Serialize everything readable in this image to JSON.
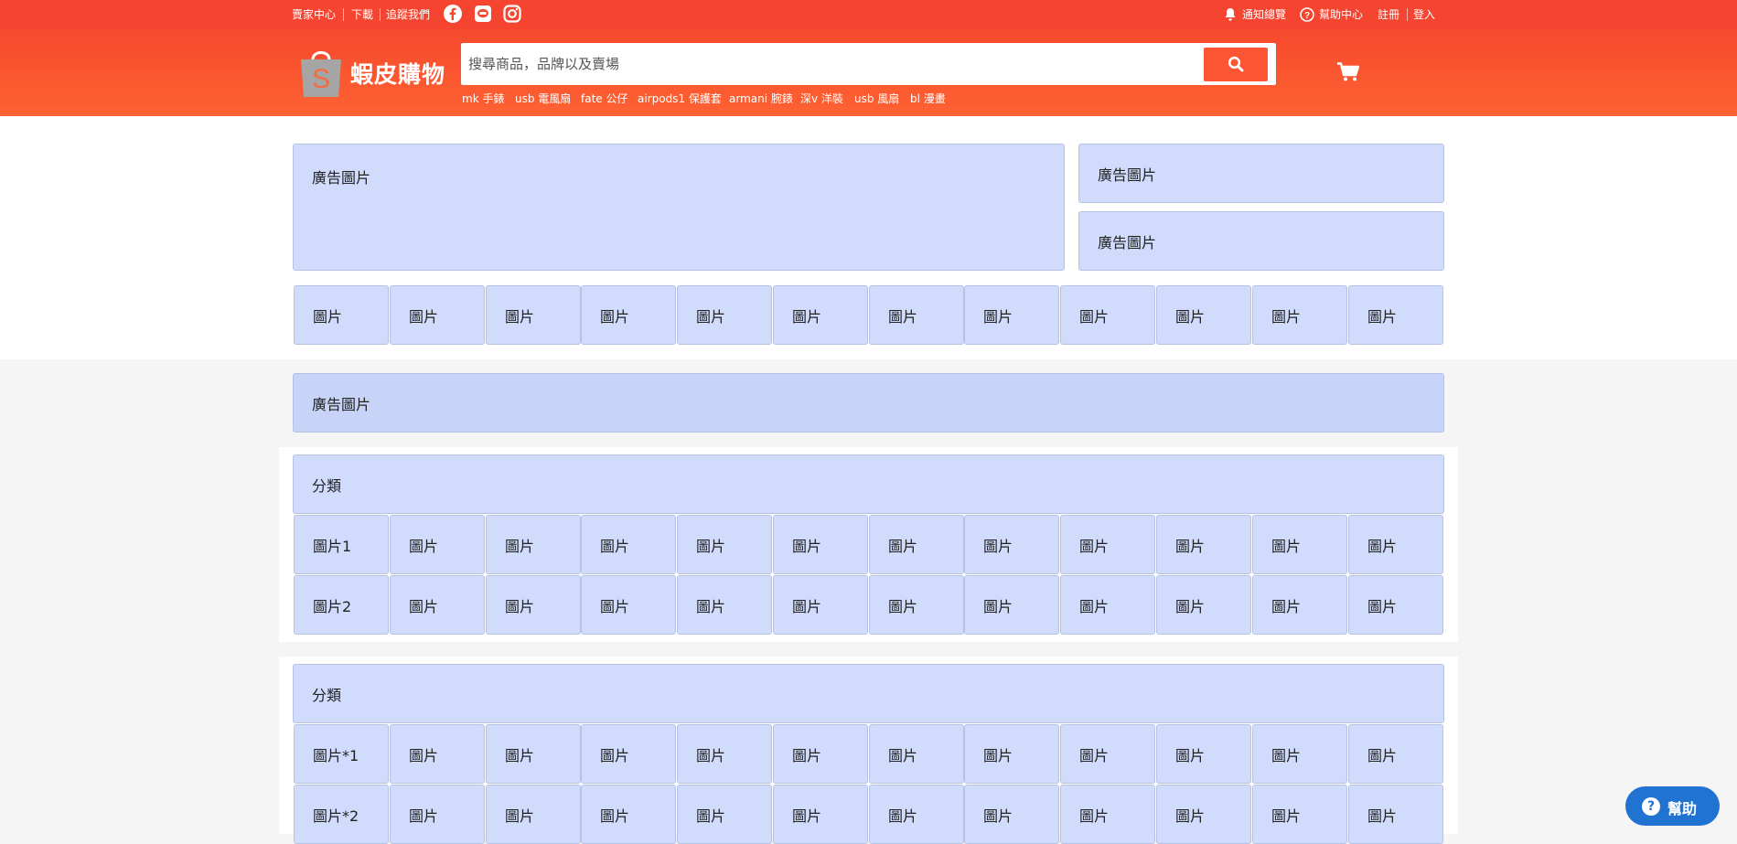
{
  "top_bar": {
    "seller_center": "賣家中心",
    "download": "下載",
    "follow_us": "追蹤我們",
    "social_icons": [
      "facebook-icon",
      "line-icon",
      "instagram-icon"
    ],
    "notifications": "通知總覽",
    "help_center": "幫助中心",
    "register": "註冊",
    "login": "登入"
  },
  "header": {
    "logo_text": "蝦皮購物",
    "logo_letter": "S",
    "search_placeholder": "搜尋商品，品牌以及賣場",
    "search_icon": "search-icon",
    "cart_icon": "cart-icon",
    "hot_keywords": [
      "mk 手錶",
      "usb 電風扇",
      "fate 公仔",
      "airpods1 保護套",
      "armani 腕錶",
      "深v 洋裝",
      "usb 風扇",
      "bl 漫畫"
    ]
  },
  "ads": {
    "main": "廣告圖片",
    "side_top": "廣告圖片",
    "side_bottom": "廣告圖片",
    "banner": "廣告圖片"
  },
  "quick_links": [
    "圖片",
    "圖片",
    "圖片",
    "圖片",
    "圖片",
    "圖片",
    "圖片",
    "圖片",
    "圖片",
    "圖片",
    "圖片",
    "圖片"
  ],
  "category_sections": [
    {
      "title": "分類",
      "rows": [
        [
          "圖片1",
          "圖片",
          "圖片",
          "圖片",
          "圖片",
          "圖片",
          "圖片",
          "圖片",
          "圖片",
          "圖片",
          "圖片",
          "圖片"
        ],
        [
          "圖片2",
          "圖片",
          "圖片",
          "圖片",
          "圖片",
          "圖片",
          "圖片",
          "圖片",
          "圖片",
          "圖片",
          "圖片",
          "圖片"
        ]
      ]
    },
    {
      "title": "分類",
      "rows": [
        [
          "圖片*1",
          "圖片",
          "圖片",
          "圖片",
          "圖片",
          "圖片",
          "圖片",
          "圖片",
          "圖片",
          "圖片",
          "圖片",
          "圖片"
        ],
        [
          "圖片*2",
          "圖片",
          "圖片",
          "圖片",
          "圖片",
          "圖片",
          "圖片",
          "圖片",
          "圖片",
          "圖片",
          "圖片",
          "圖片"
        ]
      ]
    }
  ],
  "help_button": {
    "label": "幫助",
    "icon": "question-icon"
  },
  "colors": {
    "brand": "#f54430",
    "header_gradient_end": "#fe6232",
    "search_button": "#fb5533",
    "placeholder_box": "#d1dcfd",
    "help_button": "#2173d1"
  }
}
